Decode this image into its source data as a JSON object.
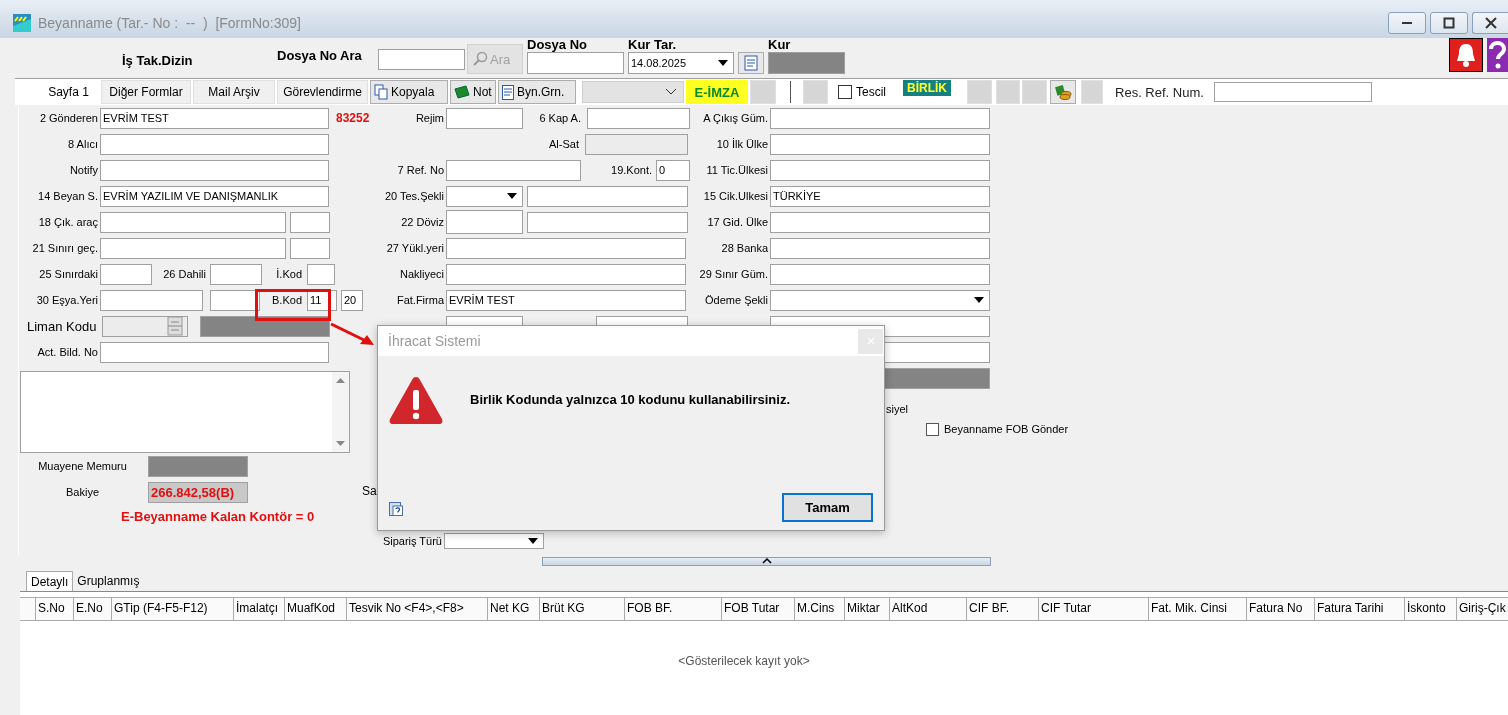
{
  "window": {
    "title": "Beyanname (Tar.- No :  --  )  [FormNo:309]"
  },
  "header": {
    "folder_label": "İş Tak.Dizin",
    "search_label": "Dosya No Ara",
    "search_button": "Ara",
    "file_no_label": "Dosya No",
    "rate_date_label": "Kur Tar.",
    "rate_date": "14.08.2025",
    "rate_label": "Kur"
  },
  "tabs": [
    {
      "label": "Sayfa 1",
      "selected": true
    },
    {
      "label": "Diğer Formlar",
      "selected": false
    },
    {
      "label": "Mail Arşiv",
      "selected": false
    },
    {
      "label": "Görevlendirme",
      "selected": false
    }
  ],
  "toolbar": {
    "copy": "Kopyala",
    "note": "Not",
    "declarant": "Byn.Grn.",
    "esign": "E-İMZA",
    "registration": {
      "label": "Tescil",
      "checked": false
    },
    "union": "BİRLİK",
    "res_ref_label": "Res. Ref. Num."
  },
  "left_rows": [
    {
      "label": "2 Gönderen",
      "items": [
        {
          "kind": "input",
          "value": "EVRİM TEST"
        },
        {
          "kind": "note",
          "text": "83252"
        }
      ]
    },
    {
      "label": "8 Alıcı",
      "items": [
        {
          "kind": "input"
        }
      ]
    },
    {
      "label": "Notify",
      "items": [
        {
          "kind": "input"
        }
      ]
    },
    {
      "label": "14 Beyan S.",
      "items": [
        {
          "kind": "input",
          "value": "EVRİM YAZILIM VE DANIŞMANLIK"
        }
      ]
    },
    {
      "label": "18 Çık. araç",
      "items": [
        {
          "kind": "input"
        },
        {
          "kind": "input"
        }
      ]
    },
    {
      "label": "21 Sınırı geç.",
      "items": [
        {
          "kind": "input"
        },
        {
          "kind": "input"
        }
      ]
    },
    {
      "label": "25 Sınırdaki",
      "items": [
        {
          "kind": "input"
        },
        {
          "kind": "label",
          "text": "26 Dahili"
        },
        {
          "kind": "input"
        },
        {
          "kind": "label",
          "text": "İ.Kod"
        },
        {
          "kind": "input"
        }
      ]
    },
    {
      "label": "30 Eşya.Yeri",
      "items": [
        {
          "kind": "input"
        },
        {
          "kind": "input"
        },
        {
          "kind": "label",
          "text": "B.Kod"
        },
        {
          "kind": "input",
          "value": "11"
        },
        {
          "kind": "input",
          "value": "20"
        }
      ]
    },
    {
      "label": "Liman Kodu",
      "items": [
        {
          "kind": "spin"
        },
        {
          "kind": "dark"
        }
      ]
    },
    {
      "label": "Act. Bild. No",
      "items": [
        {
          "kind": "input"
        }
      ]
    }
  ],
  "left_tail": [
    {
      "label": "Muayene Memuru",
      "items": [
        {
          "kind": "dark"
        }
      ]
    },
    {
      "label": "Bakiye",
      "items": [
        {
          "kind": "balance",
          "value": "266.842,58(B)"
        }
      ]
    }
  ],
  "credit_notice": "E-Beyanname Kalan Kontör = 0",
  "middle_rows": [
    {
      "label": "Rejim",
      "items": [
        {
          "kind": "input"
        },
        {
          "kind": "label",
          "text": "6 Kap A."
        },
        {
          "kind": "input"
        }
      ]
    },
    {
      "items": [
        {
          "kind": "label",
          "text": "Al-Sat"
        },
        {
          "kind": "readonly"
        }
      ]
    },
    {
      "label": "7 Ref. No",
      "items": [
        {
          "kind": "input"
        },
        {
          "kind": "label",
          "text": "19.Kont."
        },
        {
          "kind": "input",
          "value": "0"
        }
      ]
    },
    {
      "label": "20 Tes.Şekli",
      "items": [
        {
          "kind": "combo"
        },
        {
          "kind": "input"
        }
      ]
    },
    {
      "label": "22 Döviz",
      "items": [
        {
          "kind": "input"
        },
        {
          "kind": "input"
        }
      ]
    },
    {
      "label": "27 Yükl.yeri",
      "items": [
        {
          "kind": "input"
        }
      ]
    },
    {
      "label": "Nakliyeci",
      "items": [
        {
          "kind": "input"
        }
      ]
    },
    {
      "label": "Fat.Firma",
      "items": [
        {
          "kind": "input",
          "value": "EVRİM TEST"
        }
      ]
    },
    {
      "items": [
        {
          "kind": "input"
        },
        {
          "kind": "input"
        }
      ]
    }
  ],
  "middle_tail": [
    {
      "label": "Sa"
    },
    {
      "label": "Sipariş Türü",
      "items": [
        {
          "kind": "combo"
        }
      ]
    }
  ],
  "right_rows": [
    {
      "label": "A Çıkış Güm.",
      "items": [
        {
          "kind": "input"
        }
      ]
    },
    {
      "label": "10 İlk Ülke",
      "items": [
        {
          "kind": "input"
        }
      ]
    },
    {
      "label": "11 Tic.Ülkesi",
      "items": [
        {
          "kind": "input"
        }
      ]
    },
    {
      "label": "15 Cik.Ulkesi",
      "items": [
        {
          "kind": "input",
          "value": "TÜRKİYE"
        }
      ]
    },
    {
      "label": "17 Gid. Ülke",
      "items": [
        {
          "kind": "input"
        }
      ]
    },
    {
      "label": "28 Banka",
      "items": [
        {
          "kind": "input"
        }
      ]
    },
    {
      "label": "29 Sınır Güm.",
      "items": [
        {
          "kind": "input"
        }
      ]
    },
    {
      "label": "Ödeme Şekli",
      "items": [
        {
          "kind": "combo"
        }
      ]
    },
    {
      "items": [
        {
          "kind": "input"
        }
      ]
    },
    {
      "items": [
        {
          "kind": "input"
        }
      ]
    },
    {
      "items": [
        {
          "kind": "dark"
        }
      ]
    }
  ],
  "right_tail_text": "siyel",
  "fob": {
    "label": "Beyanname FOB Gönder",
    "checked": false
  },
  "dialog": {
    "title": "İhracat Sistemi",
    "message": "Birlik Kodunda yalnızca 10 kodunu kullanabilirsiniz.",
    "button": "Tamam"
  },
  "detail_tabs": [
    {
      "label": "Detaylı",
      "selected": true
    },
    {
      "label": "Gruplanmış",
      "selected": false
    }
  ],
  "table": {
    "columns": [
      "S.No",
      "E.No",
      "GTip (F4-F5-F12)",
      "İmalatçı",
      "MuafKod",
      "Tesvik No <F4>,<F8>",
      "Net KG",
      "Brüt KG",
      "FOB BF.",
      "FOB Tutar",
      "M.Cins",
      "Miktar",
      "AltKod",
      "CIF BF.",
      "CIF Tutar",
      "Fat. Mik. Cinsi",
      "Fatura No",
      "Fatura Tarihi",
      "İskonto",
      "Giriş-Çık"
    ],
    "empty_text": "<Gösterilecek kayıt yok>"
  }
}
